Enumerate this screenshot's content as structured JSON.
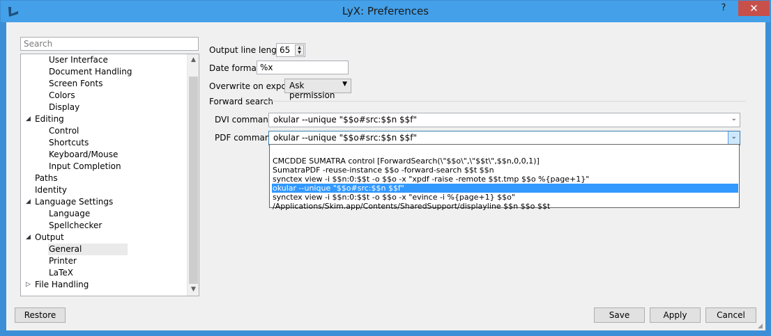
{
  "window": {
    "title": "LyX: Preferences",
    "help_label": "?",
    "close_label": "✕"
  },
  "sidebar": {
    "search_placeholder": "Search",
    "items": [
      {
        "label": "User Interface"
      },
      {
        "label": "Document Handling"
      },
      {
        "label": "Screen Fonts"
      },
      {
        "label": "Colors"
      },
      {
        "label": "Display"
      },
      {
        "label": "Editing",
        "expander": "◢"
      },
      {
        "label": "Control"
      },
      {
        "label": "Shortcuts"
      },
      {
        "label": "Keyboard/Mouse"
      },
      {
        "label": "Input Completion"
      },
      {
        "label": "Paths"
      },
      {
        "label": "Identity"
      },
      {
        "label": "Language Settings",
        "expander": "◢"
      },
      {
        "label": "Language"
      },
      {
        "label": "Spellchecker"
      },
      {
        "label": "Output",
        "expander": "◢"
      },
      {
        "label": "General"
      },
      {
        "label": "Printer"
      },
      {
        "label": "LaTeX"
      },
      {
        "label": "File Handling",
        "expander": "▷"
      }
    ]
  },
  "form": {
    "line_length_label": "Output line length:",
    "line_length_value": "65",
    "date_format_label": "Date format:",
    "date_format_value": "%x",
    "overwrite_label": "Overwrite on export:",
    "overwrite_value": "Ask permission",
    "forward_search_label": "Forward search",
    "dvi_label": "DVI command:",
    "dvi_value": "okular --unique \"$$o#src:$$n $$f\"",
    "pdf_label": "PDF command:",
    "pdf_value": "okular --unique \"$$o#src:$$n $$f\"",
    "pdf_options": [
      "",
      "CMCDDE SUMATRA control [ForwardSearch(\\\"$$o\\\",\\\"$$t\\\",$$n,0,0,1)]",
      "SumatraPDF -reuse-instance $$o -forward-search $$t $$n",
      "synctex view -i $$n:0:$$t -o $$o -x \"xpdf -raise -remote $$t.tmp $$o %{page+1}\"",
      "okular --unique \"$$o#src:$$n $$f\"",
      "synctex view -i $$n:0:$$t -o $$o -x \"evince -i %{page+1} $$o\"",
      "/Applications/Skim.app/Contents/SharedSupport/displayline $$n $$o $$t"
    ]
  },
  "buttons": {
    "restore": "Restore",
    "save": "Save",
    "apply": "Apply",
    "cancel": "Cancel"
  }
}
